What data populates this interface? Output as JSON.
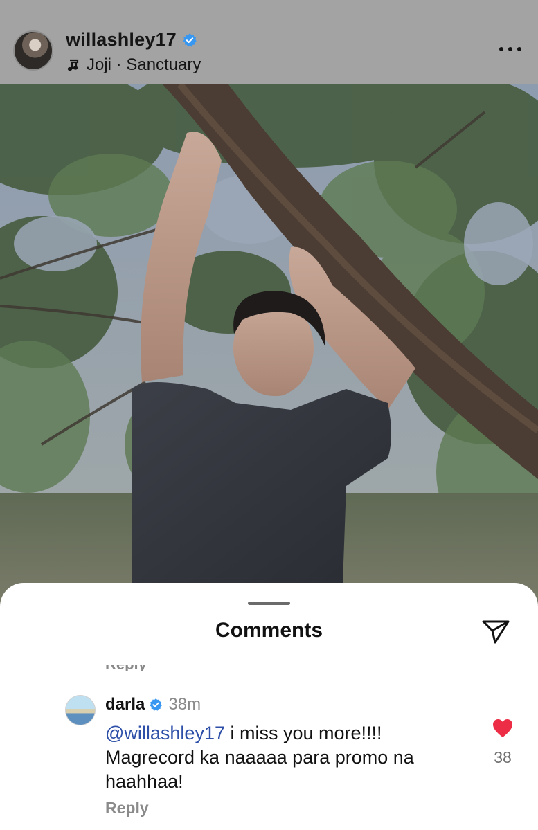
{
  "post_header": {
    "username": "willashley17",
    "verified": true,
    "music": "Joji · Sanctuary",
    "avatar_icon": "profile-photo",
    "more_icon": "more-horizontal-icon"
  },
  "photo": {
    "description_icon": "post-photo"
  },
  "comments_sheet": {
    "title": "Comments",
    "share_icon": "paper-plane-icon",
    "clipped_reply_label": "Reply"
  },
  "comment": {
    "username": "darla",
    "verified": true,
    "time": "38m",
    "mention": "@willashley17",
    "text": " i miss you more!!!! Magrecord ka naaaaa para promo na haahhaa!",
    "reply_label": "Reply",
    "like_count": "38",
    "liked": true
  },
  "colors": {
    "verified_blue": "#3897f0",
    "like_red": "#ed2d45",
    "mention_blue": "#2d4fa8",
    "header_dim": "#a3a3a3"
  }
}
